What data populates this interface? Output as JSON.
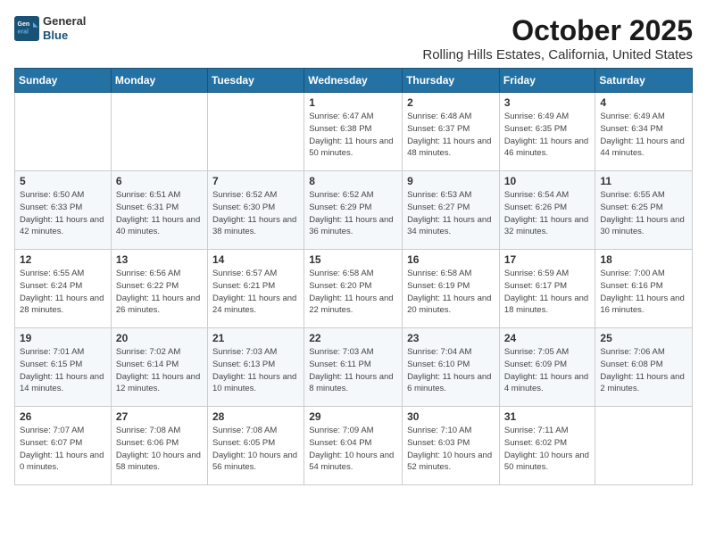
{
  "header": {
    "logo": {
      "general": "General",
      "blue": "Blue"
    },
    "title": "October 2025",
    "location": "Rolling Hills Estates, California, United States"
  },
  "calendar": {
    "days_of_week": [
      "Sunday",
      "Monday",
      "Tuesday",
      "Wednesday",
      "Thursday",
      "Friday",
      "Saturday"
    ],
    "weeks": [
      [
        null,
        null,
        null,
        {
          "day": 1,
          "sunrise": "6:47 AM",
          "sunset": "6:38 PM",
          "daylight": "11 hours and 50 minutes."
        },
        {
          "day": 2,
          "sunrise": "6:48 AM",
          "sunset": "6:37 PM",
          "daylight": "11 hours and 48 minutes."
        },
        {
          "day": 3,
          "sunrise": "6:49 AM",
          "sunset": "6:35 PM",
          "daylight": "11 hours and 46 minutes."
        },
        {
          "day": 4,
          "sunrise": "6:49 AM",
          "sunset": "6:34 PM",
          "daylight": "11 hours and 44 minutes."
        }
      ],
      [
        {
          "day": 5,
          "sunrise": "6:50 AM",
          "sunset": "6:33 PM",
          "daylight": "11 hours and 42 minutes."
        },
        {
          "day": 6,
          "sunrise": "6:51 AM",
          "sunset": "6:31 PM",
          "daylight": "11 hours and 40 minutes."
        },
        {
          "day": 7,
          "sunrise": "6:52 AM",
          "sunset": "6:30 PM",
          "daylight": "11 hours and 38 minutes."
        },
        {
          "day": 8,
          "sunrise": "6:52 AM",
          "sunset": "6:29 PM",
          "daylight": "11 hours and 36 minutes."
        },
        {
          "day": 9,
          "sunrise": "6:53 AM",
          "sunset": "6:27 PM",
          "daylight": "11 hours and 34 minutes."
        },
        {
          "day": 10,
          "sunrise": "6:54 AM",
          "sunset": "6:26 PM",
          "daylight": "11 hours and 32 minutes."
        },
        {
          "day": 11,
          "sunrise": "6:55 AM",
          "sunset": "6:25 PM",
          "daylight": "11 hours and 30 minutes."
        }
      ],
      [
        {
          "day": 12,
          "sunrise": "6:55 AM",
          "sunset": "6:24 PM",
          "daylight": "11 hours and 28 minutes."
        },
        {
          "day": 13,
          "sunrise": "6:56 AM",
          "sunset": "6:22 PM",
          "daylight": "11 hours and 26 minutes."
        },
        {
          "day": 14,
          "sunrise": "6:57 AM",
          "sunset": "6:21 PM",
          "daylight": "11 hours and 24 minutes."
        },
        {
          "day": 15,
          "sunrise": "6:58 AM",
          "sunset": "6:20 PM",
          "daylight": "11 hours and 22 minutes."
        },
        {
          "day": 16,
          "sunrise": "6:58 AM",
          "sunset": "6:19 PM",
          "daylight": "11 hours and 20 minutes."
        },
        {
          "day": 17,
          "sunrise": "6:59 AM",
          "sunset": "6:17 PM",
          "daylight": "11 hours and 18 minutes."
        },
        {
          "day": 18,
          "sunrise": "7:00 AM",
          "sunset": "6:16 PM",
          "daylight": "11 hours and 16 minutes."
        }
      ],
      [
        {
          "day": 19,
          "sunrise": "7:01 AM",
          "sunset": "6:15 PM",
          "daylight": "11 hours and 14 minutes."
        },
        {
          "day": 20,
          "sunrise": "7:02 AM",
          "sunset": "6:14 PM",
          "daylight": "11 hours and 12 minutes."
        },
        {
          "day": 21,
          "sunrise": "7:03 AM",
          "sunset": "6:13 PM",
          "daylight": "11 hours and 10 minutes."
        },
        {
          "day": 22,
          "sunrise": "7:03 AM",
          "sunset": "6:11 PM",
          "daylight": "11 hours and 8 minutes."
        },
        {
          "day": 23,
          "sunrise": "7:04 AM",
          "sunset": "6:10 PM",
          "daylight": "11 hours and 6 minutes."
        },
        {
          "day": 24,
          "sunrise": "7:05 AM",
          "sunset": "6:09 PM",
          "daylight": "11 hours and 4 minutes."
        },
        {
          "day": 25,
          "sunrise": "7:06 AM",
          "sunset": "6:08 PM",
          "daylight": "11 hours and 2 minutes."
        }
      ],
      [
        {
          "day": 26,
          "sunrise": "7:07 AM",
          "sunset": "6:07 PM",
          "daylight": "11 hours and 0 minutes."
        },
        {
          "day": 27,
          "sunrise": "7:08 AM",
          "sunset": "6:06 PM",
          "daylight": "10 hours and 58 minutes."
        },
        {
          "day": 28,
          "sunrise": "7:08 AM",
          "sunset": "6:05 PM",
          "daylight": "10 hours and 56 minutes."
        },
        {
          "day": 29,
          "sunrise": "7:09 AM",
          "sunset": "6:04 PM",
          "daylight": "10 hours and 54 minutes."
        },
        {
          "day": 30,
          "sunrise": "7:10 AM",
          "sunset": "6:03 PM",
          "daylight": "10 hours and 52 minutes."
        },
        {
          "day": 31,
          "sunrise": "7:11 AM",
          "sunset": "6:02 PM",
          "daylight": "10 hours and 50 minutes."
        },
        null
      ]
    ]
  }
}
